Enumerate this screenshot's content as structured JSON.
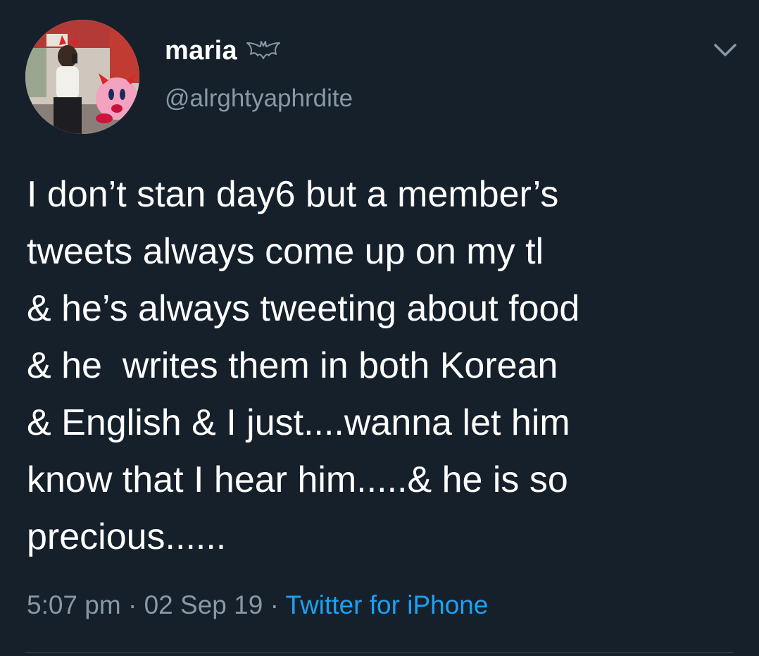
{
  "user": {
    "display_name": "maria",
    "badge_icon": "bat-icon",
    "handle": "@alrghtyaphrdite"
  },
  "tweet": {
    "lines": [
      "I don’t stan day6 but a member’s",
      "tweets always come up on my tl",
      "& he’s always tweeting about food",
      "& he  writes them in both Korean",
      "& English & I just....wanna let him",
      "know that I hear him.....& he is so",
      "precious......"
    ],
    "time": "5:07 pm",
    "separator": " · ",
    "date": "02 Sep 19",
    "source": "Twitter for iPhone"
  },
  "colors": {
    "background": "#15202b",
    "text_primary": "#ffffff",
    "text_secondary": "#8899a6",
    "link": "#1da1f2",
    "divider": "#38444d"
  },
  "icons": {
    "menu": "chevron-down-icon"
  }
}
